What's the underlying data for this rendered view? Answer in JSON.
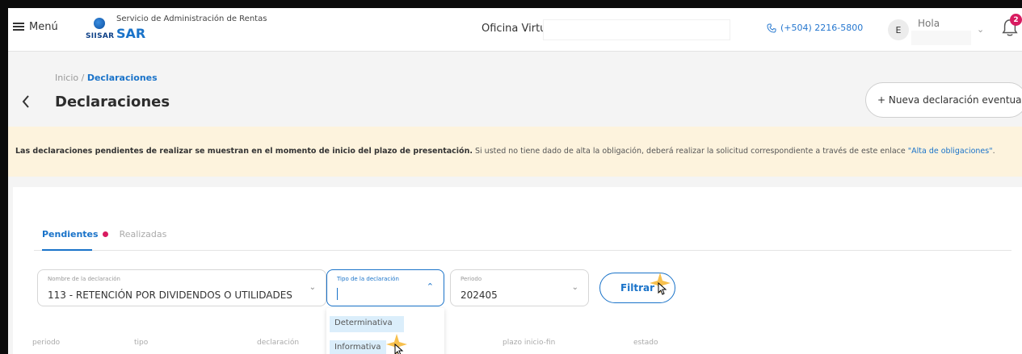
{
  "header": {
    "menu_label": "Menú",
    "logo_text": "SIISAR",
    "org_name": "Servicio de Administración de Rentas",
    "org_short": "SAR",
    "office_label": "Oficina Virtual",
    "phone": "(+504) 2216-5800",
    "avatar_initial": "E",
    "greeting": "Hola",
    "notification_count": "2"
  },
  "breadcrumb": {
    "home": "Inicio",
    "separator": " / ",
    "current": "Declaraciones"
  },
  "page": {
    "title": "Declaraciones",
    "back_icon": "chevron-left-icon",
    "new_button": "+ Nueva declaración eventual"
  },
  "notice": {
    "bold": "Las declaraciones pendientes de realizar se muestran en el momento de inicio del plazo de presentación.",
    "text": " Si usted no tiene dado de alta la obligación, deberá realizar la solicitud correspondiente a través de este enlace ",
    "link": "\"Alta de obligaciones\"",
    "end": "."
  },
  "tabs": {
    "active": "Pendientes",
    "inactive": "Realizadas"
  },
  "filters": {
    "name_label": "Nombre de la declaración",
    "name_value": "113 - RETENCIÓN POR DIVIDENDOS O UTILIDADES",
    "type_label": "Tipo de la declaración",
    "type_value": "",
    "period_label": "Periodo",
    "period_value": "202405",
    "filter_button": "Filtrar"
  },
  "type_options": [
    "Determinativa",
    "Informativa"
  ],
  "table_headers": {
    "periodo": "periodo",
    "tipo": "tipo",
    "declaracion": "declaración",
    "plazo": "plazo inicio-fin",
    "estado": "estado"
  },
  "colors": {
    "accent": "#1a73c9",
    "badge": "#d81b60",
    "notice_bg": "#fdf3dd"
  }
}
